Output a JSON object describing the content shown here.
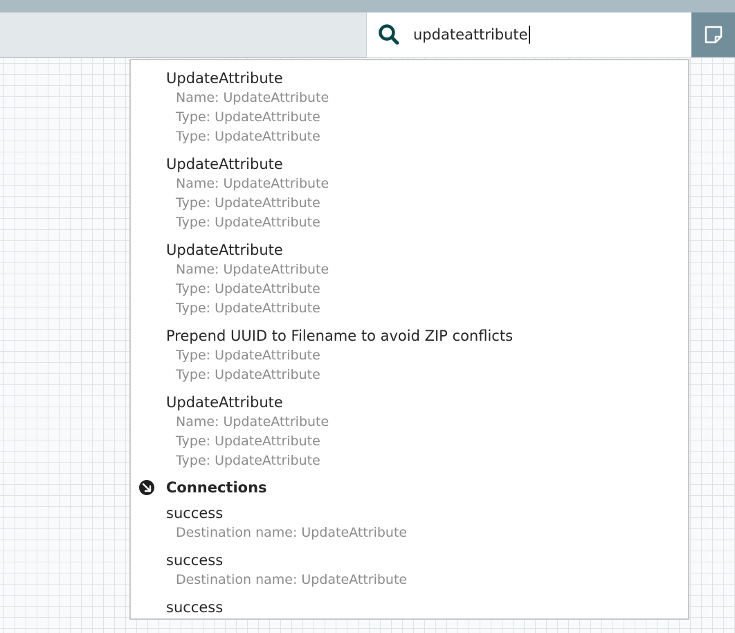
{
  "search": {
    "value": "updateattribute",
    "icon": "search-icon"
  },
  "toolbar": {
    "note_icon": "sticky-note-icon"
  },
  "results": {
    "processors": [
      {
        "title": "UpdateAttribute",
        "details": [
          "Name: UpdateAttribute",
          "Type: UpdateAttribute",
          "Type: UpdateAttribute"
        ]
      },
      {
        "title": "UpdateAttribute",
        "details": [
          "Name: UpdateAttribute",
          "Type: UpdateAttribute",
          "Type: UpdateAttribute"
        ]
      },
      {
        "title": "UpdateAttribute",
        "details": [
          "Name: UpdateAttribute",
          "Type: UpdateAttribute",
          "Type: UpdateAttribute"
        ]
      },
      {
        "title": "Prepend UUID to Filename to avoid ZIP conflicts",
        "details": [
          "Type: UpdateAttribute",
          "Type: UpdateAttribute"
        ]
      },
      {
        "title": "UpdateAttribute",
        "details": [
          "Name: UpdateAttribute",
          "Type: UpdateAttribute",
          "Type: UpdateAttribute"
        ]
      }
    ],
    "connections_header": "Connections",
    "connections_icon": "connection-icon",
    "connections": [
      {
        "title": "success",
        "details": [
          "Destination name: UpdateAttribute"
        ]
      },
      {
        "title": "success",
        "details": [
          "Destination name: UpdateAttribute"
        ]
      },
      {
        "title": "success",
        "details": []
      }
    ]
  },
  "colors": {
    "top_strip": "#aabbc3",
    "toolbar": "#e3e8eb",
    "search_icon": "#004849",
    "note_button": "#728e9b"
  }
}
